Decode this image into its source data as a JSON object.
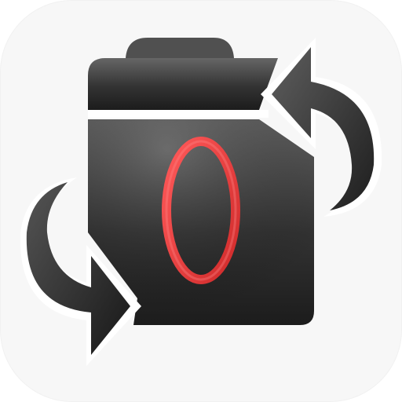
{
  "app_icon": {
    "name": "camera-rotate-app-icon",
    "colors": {
      "tile_background": "#f7f7f7",
      "body_light": "#626262",
      "body_dark": "#1d1d1d",
      "arrow_light": "#5a5a5a",
      "arrow_dark": "#202020",
      "lens_ring": "#e53838",
      "lens_ring_highlight": "#ff6a6a",
      "separator": "#ffffff"
    },
    "icons": [
      "camera-body-icon",
      "camera-flash-bump-icon",
      "camera-lens-ring-icon",
      "rotate-arrow-top-right-icon",
      "rotate-arrow-bottom-left-icon"
    ]
  }
}
